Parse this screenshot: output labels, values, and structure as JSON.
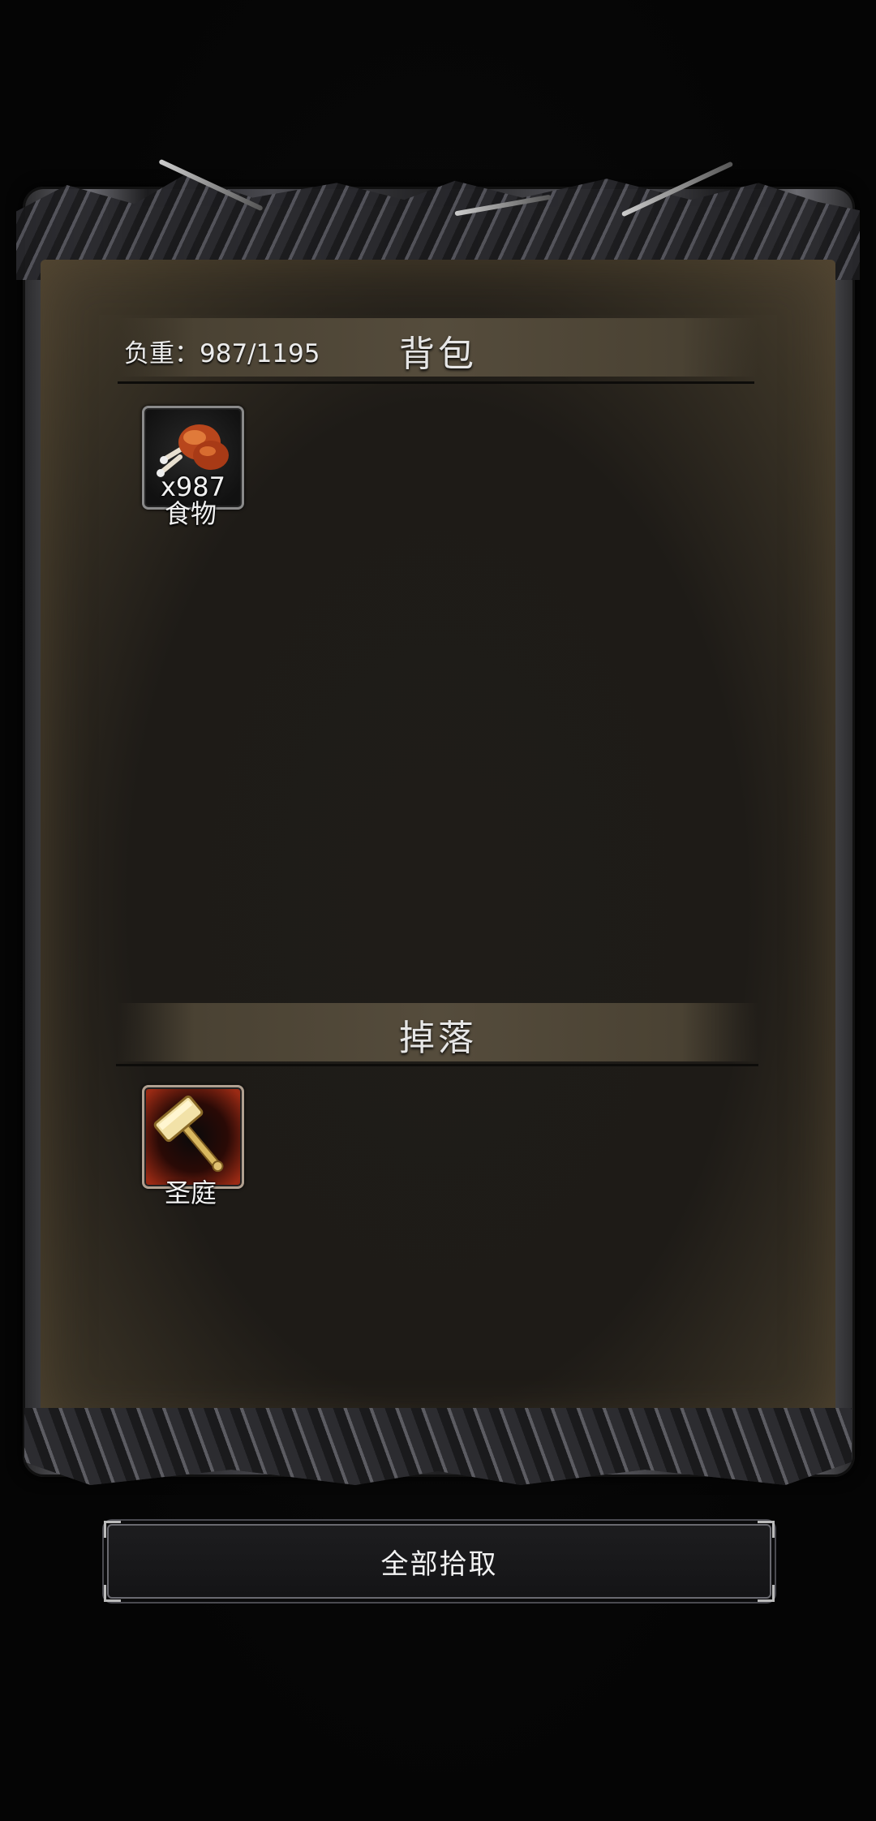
{
  "backpack": {
    "title": "背包",
    "weight_label": "负重：987/1195",
    "items": [
      {
        "name": "食物",
        "quantity": "x987",
        "icon": "roast-drumstick-icon"
      }
    ]
  },
  "drops": {
    "title": "掉落",
    "items": [
      {
        "name": "圣庭",
        "icon": "golden-hammer-icon"
      }
    ]
  },
  "actions": {
    "pickup_all_label": "全部拾取"
  },
  "colors": {
    "panel": "#1e1b17",
    "header_bar": "#554c3c",
    "drop_item_glow": "#9a2a14"
  }
}
